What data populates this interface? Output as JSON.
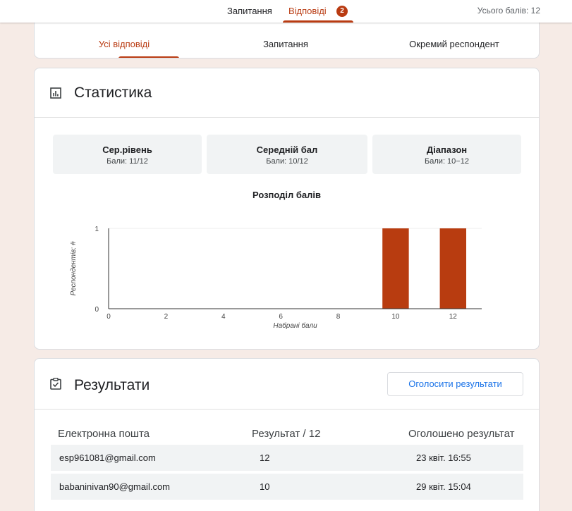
{
  "header": {
    "tabs": [
      {
        "label": "Запитання"
      },
      {
        "label": "Відповіді",
        "badge": "2"
      }
    ],
    "total_points": "Усього балів: 12"
  },
  "subnav": {
    "tabs": [
      "Усі відповіді",
      "Запитання",
      "Окремий респондент"
    ]
  },
  "stats": {
    "title": "Статистика",
    "boxes": [
      {
        "label": "Сер.рівень",
        "value": "Бали: 11/12"
      },
      {
        "label": "Середній бал",
        "value": "Бали: 10/12"
      },
      {
        "label": "Діапазон",
        "value": "Бали: 10−12"
      }
    ]
  },
  "chart_data": {
    "type": "bar",
    "title": "Розподіл балів",
    "xlabel": "Набрані бали",
    "ylabel": "Респондентів: #",
    "x": [
      10,
      12
    ],
    "values": [
      1,
      1
    ],
    "xlim": [
      0,
      13
    ],
    "ylim": [
      0,
      1
    ],
    "xticks": [
      "0",
      "2",
      "4",
      "6",
      "8",
      "10",
      "12"
    ],
    "yticks": [
      "0",
      "1"
    ],
    "grid": true,
    "color": "#b83c10"
  },
  "results": {
    "title": "Результати",
    "button_label": "Оголосити результати",
    "columns": [
      "Електронна пошта",
      "Результат / 12",
      "Оголошено результат"
    ],
    "rows": [
      {
        "email": "esp961081@gmail.com",
        "score": "12",
        "released": "23 квіт. 16:55"
      },
      {
        "email": "babaninivan90@gmail.com",
        "score": "10",
        "released": "29 квіт. 15:04"
      }
    ]
  },
  "colors": {
    "accent": "#b93b12",
    "link": "#1a73e8",
    "background": "#f6ebe6"
  }
}
